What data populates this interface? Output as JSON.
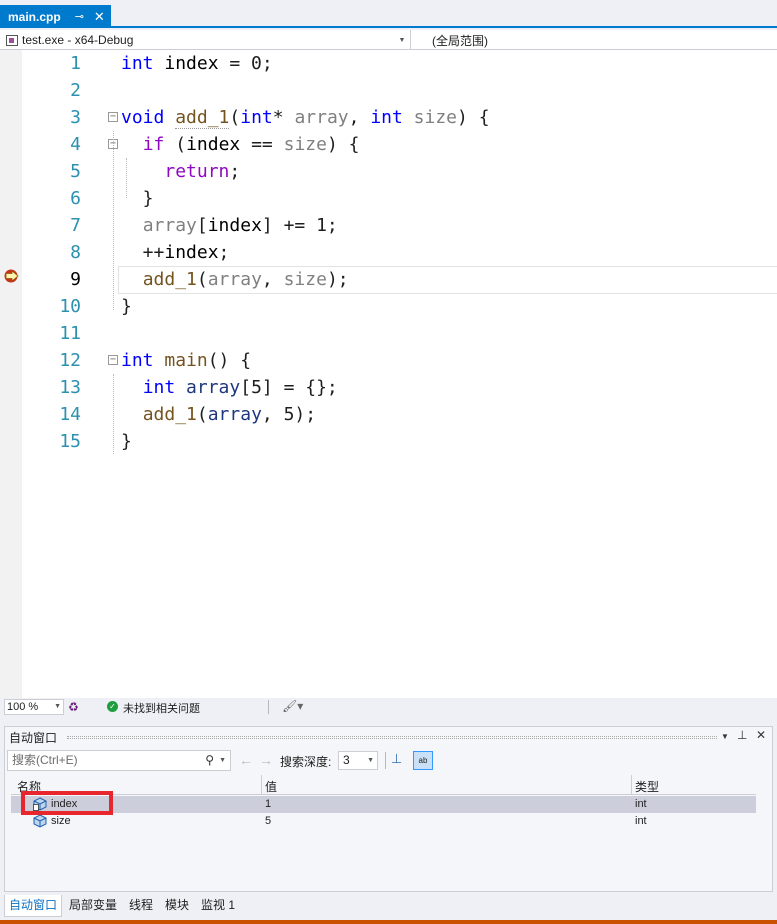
{
  "editor_tab": {
    "filename": "main.cpp",
    "pin_glyph": "⊸",
    "close_glyph": "✕"
  },
  "navbar": {
    "project": "test.exe - x64-Debug",
    "scope": "(全局范围)"
  },
  "code_lines": [
    {
      "num": "1",
      "tokens": [
        {
          "t": "int",
          "c": "kw"
        },
        {
          "t": " "
        },
        {
          "t": "index",
          "c": "gv"
        },
        {
          "t": " = 0;"
        }
      ]
    },
    {
      "num": "2",
      "tokens": []
    },
    {
      "num": "3",
      "tokens": [
        {
          "t": "void",
          "c": "kw"
        },
        {
          "t": " "
        },
        {
          "t": "add_1",
          "c": "fn squig"
        },
        {
          "t": "("
        },
        {
          "t": "int",
          "c": "kw"
        },
        {
          "t": "* "
        },
        {
          "t": "array",
          "c": "prm"
        },
        {
          "t": ", "
        },
        {
          "t": "int",
          "c": "kw"
        },
        {
          "t": " "
        },
        {
          "t": "size",
          "c": "prm"
        },
        {
          "t": ") {"
        }
      ]
    },
    {
      "num": "4",
      "tokens": [
        {
          "t": "  "
        },
        {
          "t": "if",
          "c": "ctl"
        },
        {
          "t": " ("
        },
        {
          "t": "index",
          "c": "gv"
        },
        {
          "t": " == "
        },
        {
          "t": "size",
          "c": "prm"
        },
        {
          "t": ") {"
        }
      ]
    },
    {
      "num": "5",
      "tokens": [
        {
          "t": "    "
        },
        {
          "t": "return",
          "c": "ctl"
        },
        {
          "t": ";"
        }
      ]
    },
    {
      "num": "6",
      "tokens": [
        {
          "t": "  }"
        }
      ]
    },
    {
      "num": "7",
      "tokens": [
        {
          "t": "  "
        },
        {
          "t": "array",
          "c": "prm"
        },
        {
          "t": "["
        },
        {
          "t": "index",
          "c": "gv"
        },
        {
          "t": "] += 1;"
        }
      ]
    },
    {
      "num": "8",
      "tokens": [
        {
          "t": "  ++"
        },
        {
          "t": "index",
          "c": "gv"
        },
        {
          "t": ";"
        }
      ]
    },
    {
      "num": "9",
      "tokens": [
        {
          "t": "  "
        },
        {
          "t": "add_1",
          "c": "fn"
        },
        {
          "t": "("
        },
        {
          "t": "array",
          "c": "prm"
        },
        {
          "t": ", "
        },
        {
          "t": "size",
          "c": "prm"
        },
        {
          "t": ");"
        }
      ]
    },
    {
      "num": "10",
      "tokens": [
        {
          "t": "}"
        }
      ]
    },
    {
      "num": "11",
      "tokens": []
    },
    {
      "num": "12",
      "tokens": [
        {
          "t": "int",
          "c": "kw"
        },
        {
          "t": " "
        },
        {
          "t": "main",
          "c": "fn"
        },
        {
          "t": "() {"
        }
      ]
    },
    {
      "num": "13",
      "tokens": [
        {
          "t": "  "
        },
        {
          "t": "int",
          "c": "kw"
        },
        {
          "t": " "
        },
        {
          "t": "array",
          "c": "loc"
        },
        {
          "t": "[5] = {};"
        }
      ]
    },
    {
      "num": "14",
      "tokens": [
        {
          "t": "  "
        },
        {
          "t": "add_1",
          "c": "fn"
        },
        {
          "t": "("
        },
        {
          "t": "array",
          "c": "loc"
        },
        {
          "t": ", 5);"
        }
      ]
    },
    {
      "num": "15",
      "tokens": [
        {
          "t": "}"
        }
      ]
    }
  ],
  "current_line": "9",
  "editor_status": {
    "zoom": "100 %",
    "issues": "未找到相关问题"
  },
  "autos": {
    "title": "自动窗口",
    "search_placeholder": "搜索(Ctrl+E)",
    "depth_label": "搜索深度:",
    "depth_value": "3",
    "columns": {
      "name": "名称",
      "value": "值",
      "type": "类型"
    },
    "rows": [
      {
        "name": "index",
        "value": "1",
        "type": "int"
      },
      {
        "name": "size",
        "value": "5",
        "type": "int"
      }
    ]
  },
  "bottom_tabs": [
    "自动窗口",
    "局部变量",
    "线程",
    "模块",
    "监视 1"
  ],
  "colors": {
    "accent": "#007acc",
    "keyword": "#0000ff",
    "control": "#8f08c4",
    "function": "#74531f",
    "parameter": "#808080",
    "highlight_box": "#e8262e",
    "status_bar": "#ca5100"
  }
}
